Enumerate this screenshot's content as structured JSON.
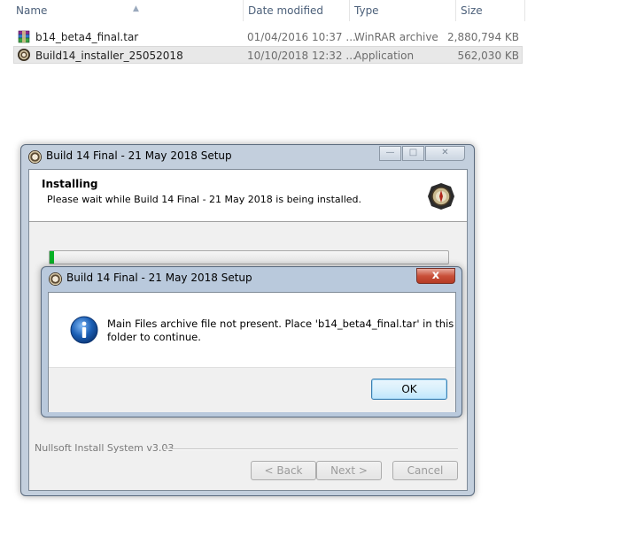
{
  "explorer": {
    "columns": {
      "name": "Name",
      "date": "Date modified",
      "type": "Type",
      "size": "Size"
    },
    "files": [
      {
        "name": "b14_beta4_final.tar",
        "date": "01/04/2016 10:37 ...",
        "type": "WinRAR archive",
        "size": "2,880,794 KB",
        "icon": "winrar-archive-icon"
      },
      {
        "name": "Build14_installer_25052018",
        "date": "10/10/2018 12:32 ...",
        "type": "Application",
        "size": "562,030 KB",
        "icon": "installer-app-icon"
      }
    ]
  },
  "setup": {
    "title": "Build 14 Final - 21 May 2018 Setup",
    "header_title": "Installing",
    "header_subtitle": "Please wait while Build 14 Final - 21 May 2018 is being installed.",
    "progress": 0.01,
    "branding": "Nullsoft Install System v3.03",
    "back_label": "< Back",
    "next_label": "Next >",
    "cancel_label": "Cancel"
  },
  "alert": {
    "title": "Build 14 Final - 21 May 2018 Setup",
    "message_line1": "Main Files archive file not present. Place 'b14_beta4_final.tar' in this",
    "message_line2": "folder to continue.",
    "ok_label": "OK",
    "close_glyph": "x",
    "icon": "information-icon"
  },
  "colors": {
    "accent": "#3c7fb1",
    "close": "#c9503a",
    "info": "#1b5fb5",
    "progress": "#06b025"
  }
}
